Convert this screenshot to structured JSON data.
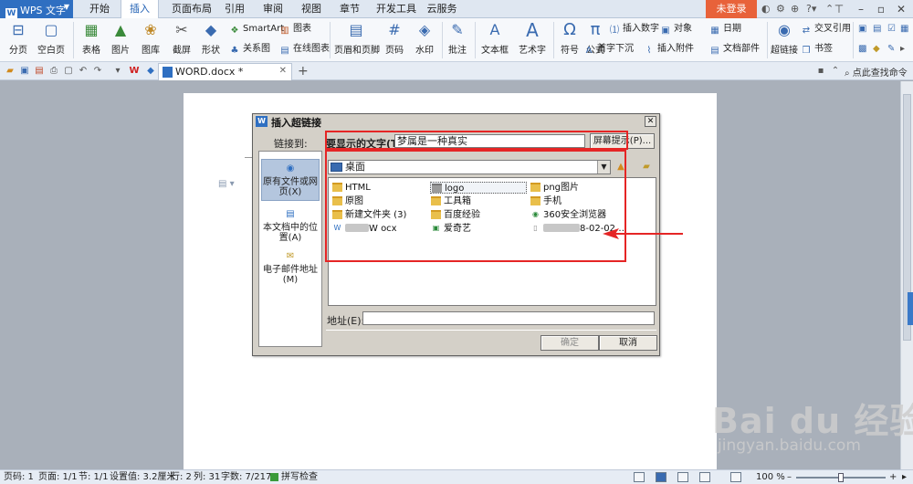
{
  "app": {
    "name": "WPS 文字",
    "logo_letter": "W"
  },
  "menu_tabs": [
    {
      "label": "开始"
    },
    {
      "label": "插入"
    },
    {
      "label": "页面布局"
    },
    {
      "label": "引用"
    },
    {
      "label": "审阅"
    },
    {
      "label": "视图"
    },
    {
      "label": "章节"
    },
    {
      "label": "开发工具"
    },
    {
      "label": "云服务"
    }
  ],
  "active_tab": "插入",
  "login": "未登录",
  "ribbon": {
    "page_break": "分页",
    "blank_page": "空白页",
    "table": "表格",
    "picture": "图片",
    "gallery": "图库",
    "screenshot": "截屏",
    "shapes": "形状",
    "smartart": "SmartArt",
    "chart": "图表",
    "relation": "关系图",
    "online_chart": "在线图表",
    "header_footer": "页眉和页脚",
    "page_number": "页码",
    "watermark": "水印",
    "comment": "批注",
    "textbox": "文本框",
    "wordart": "艺术字",
    "symbol": "符号",
    "formula": "公式",
    "insert_number": "插入数字",
    "object": "对象",
    "date": "日期",
    "drop_cap": "首字下沉",
    "insert_attachment": "插入附件",
    "doc_parts": "文档部件",
    "hyperlink": "超链接",
    "bookmark": "书签",
    "cross_ref": "交叉引用"
  },
  "doc_tab": {
    "name": "WORD.docx *"
  },
  "find_command": "点此查找命令",
  "dialog": {
    "title": "插入超链接",
    "link_to_label": "链接到:",
    "link_to_options": [
      {
        "label": "原有文件或网页(X)"
      },
      {
        "label": "本文档中的位置(A)"
      },
      {
        "label": "电子邮件地址(M)"
      }
    ],
    "display_text_label": "要显示的文字(T):",
    "display_text_value": "梦属是一种真实",
    "screentip_button": "屏幕提示(P)...",
    "look_in_value": "桌面",
    "files": [
      {
        "name": "HTML",
        "icon": "folder"
      },
      {
        "name": "logo",
        "icon": "folder"
      },
      {
        "name": "png图片",
        "icon": "folder"
      },
      {
        "name": "原图",
        "icon": "folder"
      },
      {
        "name": "工具箱",
        "icon": "folder"
      },
      {
        "name": "手机",
        "icon": "folder"
      },
      {
        "name": "新建文件夹 (3)",
        "icon": "folder"
      },
      {
        "name": "百度经验",
        "icon": "folder"
      },
      {
        "name": "360安全浏览器",
        "icon": "shortcut"
      },
      {
        "name": "W  ocx",
        "icon": "doc"
      },
      {
        "name": "爱奇艺",
        "icon": "shortcut"
      },
      {
        "name": "8-02-02…",
        "icon": "file"
      }
    ],
    "address_label": "地址(E):",
    "address_value": "",
    "ok_button": "确定",
    "cancel_button": "取消"
  },
  "status": {
    "page": "页码: 1",
    "pages": "页面: 1/1",
    "section": "节: 1/1",
    "setting": "设置值: 3.2厘米",
    "row": "行: 2",
    "col": "列: 31",
    "words": "字数: 7/217",
    "spell": "拼写检查",
    "zoom": "100 %",
    "zoom_level": 0.5
  },
  "watermark": {
    "main": "Bai du 经验",
    "sub": "jingyan.baidu.com"
  },
  "colors": {
    "accent": "#2f6fc1",
    "login": "#e8623a",
    "annotation": "#e52525"
  }
}
